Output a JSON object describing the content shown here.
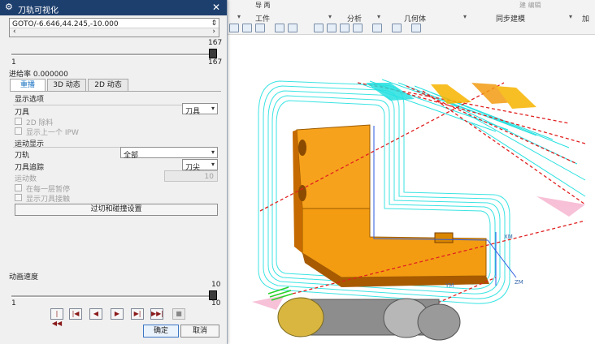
{
  "dialog": {
    "title": "刀轨可视化",
    "goto_value": "GOTO/-6.646,44.245,-10.000",
    "position_slider": {
      "max_label": "167",
      "min_label": "1",
      "value": 167
    },
    "feed_rate_label": "进给率 0.000000",
    "tabs": [
      "重播",
      "3D 动态",
      "2D 动态"
    ],
    "display_options": {
      "heading": "显示选项",
      "tool_label": "刀具",
      "tool_value": "刀具",
      "remove_2d_label": "2D 除料",
      "show_prev_ipw_label": "显示上一个 IPW"
    },
    "motion_display": {
      "heading": "运动显示",
      "toolpath_label": "刀轨",
      "toolpath_value": "全部",
      "tool_trace_label": "刀具追踪",
      "tool_trace_value": "刀尖",
      "motion_count_label": "运动数",
      "motion_count_value": "10",
      "pause_each_layer_label": "在每一层暂停",
      "show_tool_contact_label": "显示刀具接触",
      "gouge_check_button": "过切和碰撞设置"
    },
    "animation_speed": {
      "label": "动画速度",
      "max_label": "10",
      "min_label": "1",
      "max_right_label": "10",
      "value": 10
    },
    "ok_button": "确定",
    "cancel_button": "取消"
  },
  "ribbon": {
    "top_items": [
      "导 两",
      "建 编辑"
    ],
    "groups": [
      "工件",
      "分析",
      "几何体",
      "同步建模",
      "加"
    ]
  },
  "viewport": {
    "axis_labels": [
      "XM",
      "YM",
      "ZM"
    ],
    "colors": {
      "part": "#f39c12",
      "toolpath": "#26e0e0",
      "rapid": "#e02020",
      "tool": "#d9b640",
      "pink": "#f6b6d0"
    }
  }
}
